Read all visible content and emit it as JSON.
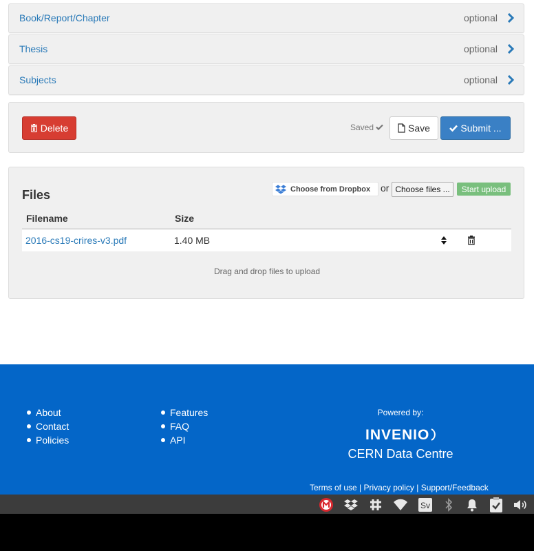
{
  "sections": [
    {
      "label": "Book/Report/Chapter",
      "status": "optional"
    },
    {
      "label": "Thesis",
      "status": "optional"
    },
    {
      "label": "Subjects",
      "status": "optional"
    }
  ],
  "actions": {
    "delete_label": "Delete",
    "saved_label": "Saved",
    "save_label": "Save",
    "submit_label": "Submit ..."
  },
  "files": {
    "title": "Files",
    "dropbox_label": "Choose from Dropbox",
    "or_label": "or",
    "choose_label": "Choose files ...",
    "upload_label": "Start upload",
    "columns": [
      "Filename",
      "Size"
    ],
    "rows": [
      {
        "name": "2016-cs19-crires-v3.pdf",
        "size": "1.40 MB"
      }
    ],
    "drop_hint": "Drag and drop files to upload"
  },
  "footer": {
    "links_col1": [
      "About",
      "Contact",
      "Policies"
    ],
    "links_col2": [
      "Features",
      "FAQ",
      "API"
    ],
    "powered_by": "Powered by:",
    "logo_text": "INVENIO",
    "org": "CERN Data Centre",
    "terms": "Terms of use",
    "privacy": "Privacy policy",
    "support": "Support/Feedback",
    "separator": "|"
  },
  "taskbar": {
    "icons": [
      "mega-icon",
      "dropbox-icon",
      "slack-icon",
      "wifi-icon",
      "sv-icon",
      "bluetooth-icon",
      "bell-icon",
      "clipboard-icon",
      "volume-icon"
    ],
    "sv_text": "Sv"
  },
  "colors": {
    "link": "#2a7ab8",
    "footer_bg": "#0466c8",
    "delete": "#d73d32",
    "submit": "#3a80c5",
    "upload": "#79bf7d"
  }
}
